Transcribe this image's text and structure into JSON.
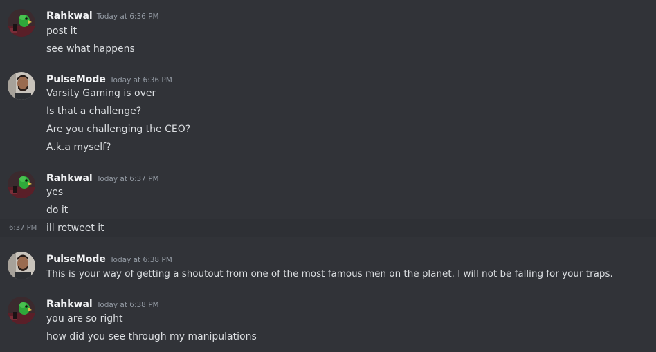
{
  "messages": [
    {
      "author": "Rahkwal",
      "timestamp": "Today at 6:36 PM",
      "avatar": "green-parrot-avatar",
      "lines": [
        "post it",
        "see what happens"
      ]
    },
    {
      "author": "PulseMode",
      "timestamp": "Today at 6:36 PM",
      "avatar": "person-photo-avatar",
      "lines": [
        "Varsity Gaming is over",
        "Is that a challenge?",
        "Are you challenging the CEO?",
        "A.k.a myself?"
      ]
    },
    {
      "author": "Rahkwal",
      "timestamp": "Today at 6:37 PM",
      "avatar": "green-parrot-avatar",
      "lines": [
        "yes",
        "do it",
        "ill retweet it"
      ],
      "hover_time": "6:37 PM"
    },
    {
      "author": "PulseMode",
      "timestamp": "Today at 6:38 PM",
      "avatar": "person-photo-avatar",
      "lines": [
        "This is your way of getting a shoutout from one of the most famous men on the planet. I will not be falling for your traps."
      ]
    },
    {
      "author": "Rahkwal",
      "timestamp": "Today at 6:38 PM",
      "avatar": "green-parrot-avatar",
      "lines": [
        "you are so right",
        "how did you see through my manipulations"
      ]
    }
  ],
  "colors": {
    "background": "#313338",
    "hover_background": "#2e3035",
    "username": "#f2f3f5",
    "timestamp": "#949ba4",
    "message_text": "#dbdee1"
  }
}
